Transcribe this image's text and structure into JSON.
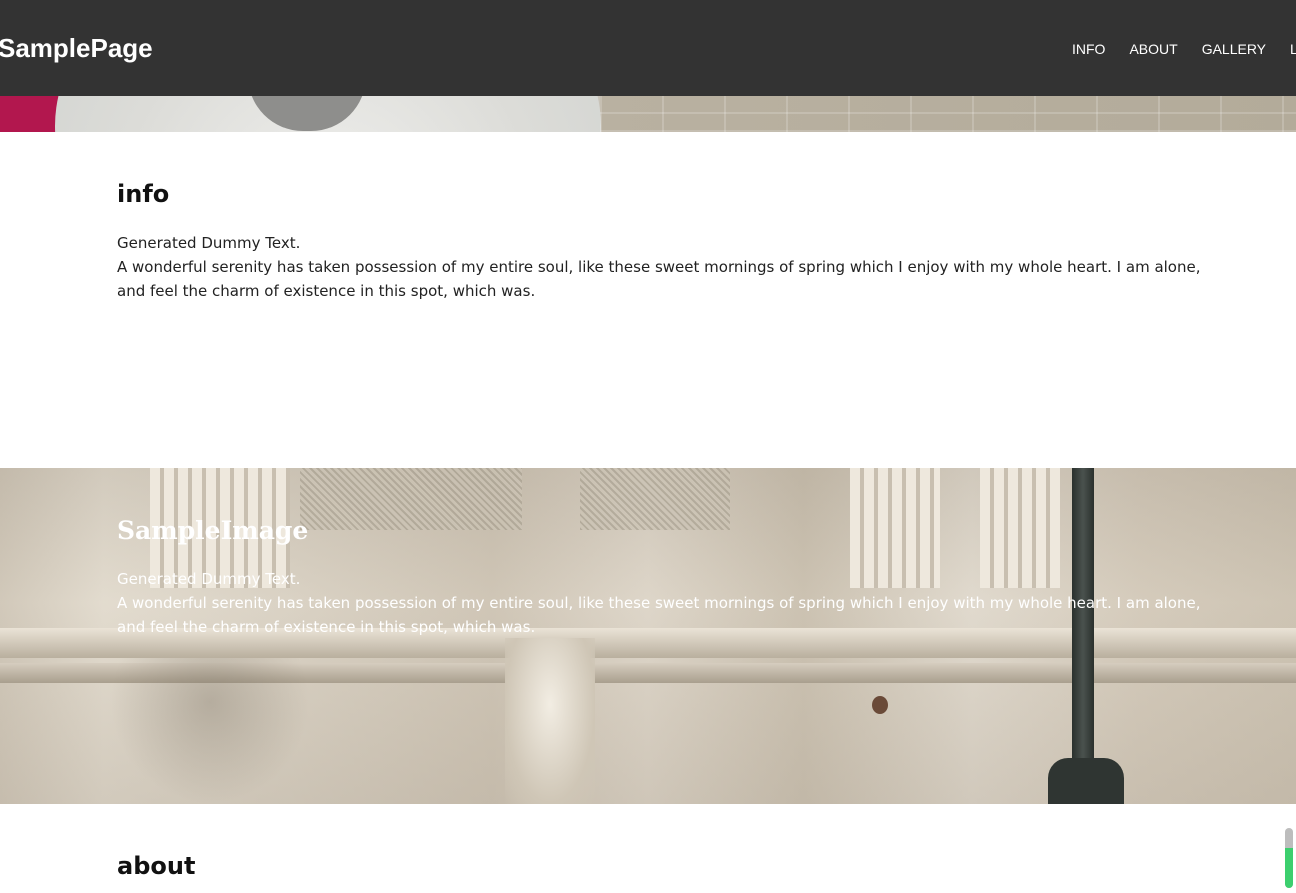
{
  "header": {
    "logo": "SamplePage",
    "nav": [
      {
        "label": "INFO"
      },
      {
        "label": "ABOUT"
      },
      {
        "label": "GALLERY"
      },
      {
        "label": "LI"
      }
    ]
  },
  "info": {
    "title": "info",
    "lead": "Generated Dummy Text.",
    "body": "A wonderful serenity has taken possession of my entire soul, like these sweet mornings of spring which I enjoy with my whole heart. I am alone, and feel the charm of existence in this spot, which was."
  },
  "sample_image": {
    "title": "SampleImage",
    "lead": "Generated Dummy Text.",
    "body": "A wonderful serenity has taken possession of my entire soul, like these sweet mornings of spring which I enjoy with my whole heart. I am alone, and feel the charm of existence in this spot, which was."
  },
  "about": {
    "title": "about"
  },
  "scroll_progress": {
    "fraction": 0.67,
    "fill_color": "#3ccf6e"
  }
}
